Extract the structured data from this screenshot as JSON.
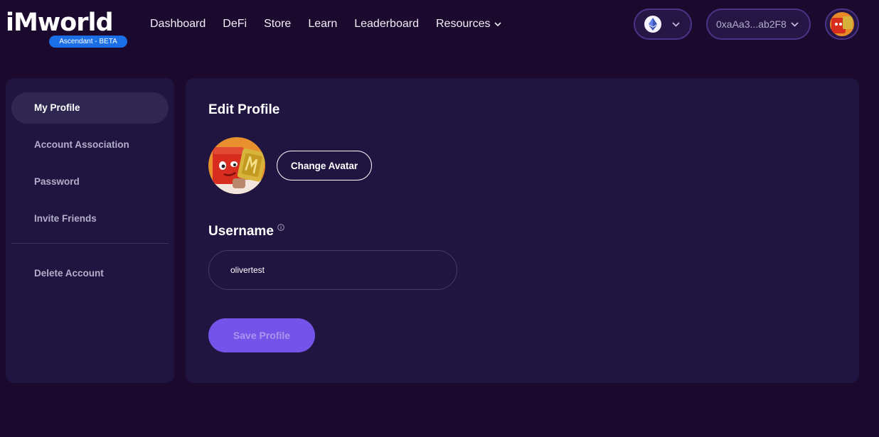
{
  "header": {
    "logo_text": "iMworld",
    "logo_badge": "Ascendant - BETA",
    "nav": [
      {
        "label": "Dashboard"
      },
      {
        "label": "DeFi"
      },
      {
        "label": "Store"
      },
      {
        "label": "Learn"
      },
      {
        "label": "Leaderboard"
      },
      {
        "label": "Resources"
      }
    ],
    "network_icon": "ethereum-icon",
    "wallet_address": "0xaAa3...ab2F8"
  },
  "sidebar": {
    "items": [
      {
        "label": "My Profile",
        "active": true
      },
      {
        "label": "Account Association"
      },
      {
        "label": "Password"
      },
      {
        "label": "Invite Friends"
      },
      {
        "label": "Delete Account"
      }
    ]
  },
  "profile": {
    "title": "Edit Profile",
    "change_avatar_label": "Change Avatar",
    "username_label": "Username",
    "username_value": "olivertest",
    "save_label": "Save Profile"
  },
  "colors": {
    "background": "#1b0a2e",
    "panel": "#201540",
    "accent": "#7353e8",
    "badge": "#1a6fe6",
    "wallet_border": "#4a3388"
  }
}
